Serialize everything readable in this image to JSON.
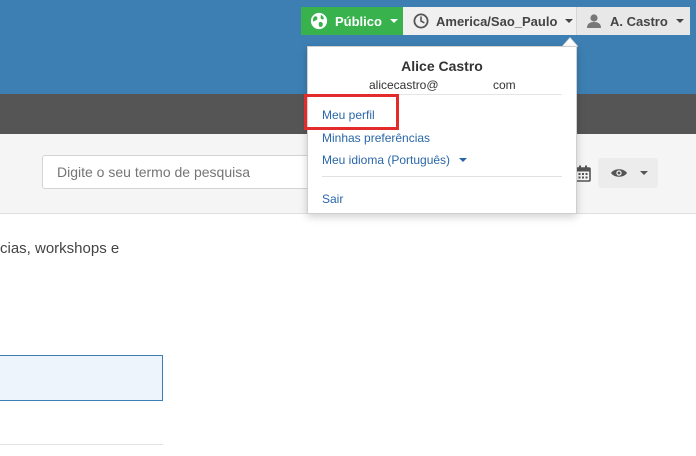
{
  "topbar": {
    "public_label": "Público",
    "timezone_label": "America/Sao_Paulo",
    "user_label": "A. Castro",
    "colors": {
      "brand": "#3d7fb2",
      "public": "#37b24d",
      "secondary_bar": "#555555"
    }
  },
  "search": {
    "placeholder": "Digite o seu termo de pesquisa"
  },
  "content": {
    "body_text": "cias, workshops e"
  },
  "dropdown": {
    "name": "Alice Castro",
    "email_user": "alicecastro@",
    "email_domain": "com",
    "items": [
      {
        "label": "Meu perfil"
      },
      {
        "label": "Minhas preferências"
      },
      {
        "label": "Meu idioma (Português)"
      },
      {
        "label": "Sair"
      }
    ]
  },
  "icons": [
    "globe-icon",
    "clock-icon",
    "user-icon",
    "calendar-icon",
    "eye-icon"
  ]
}
